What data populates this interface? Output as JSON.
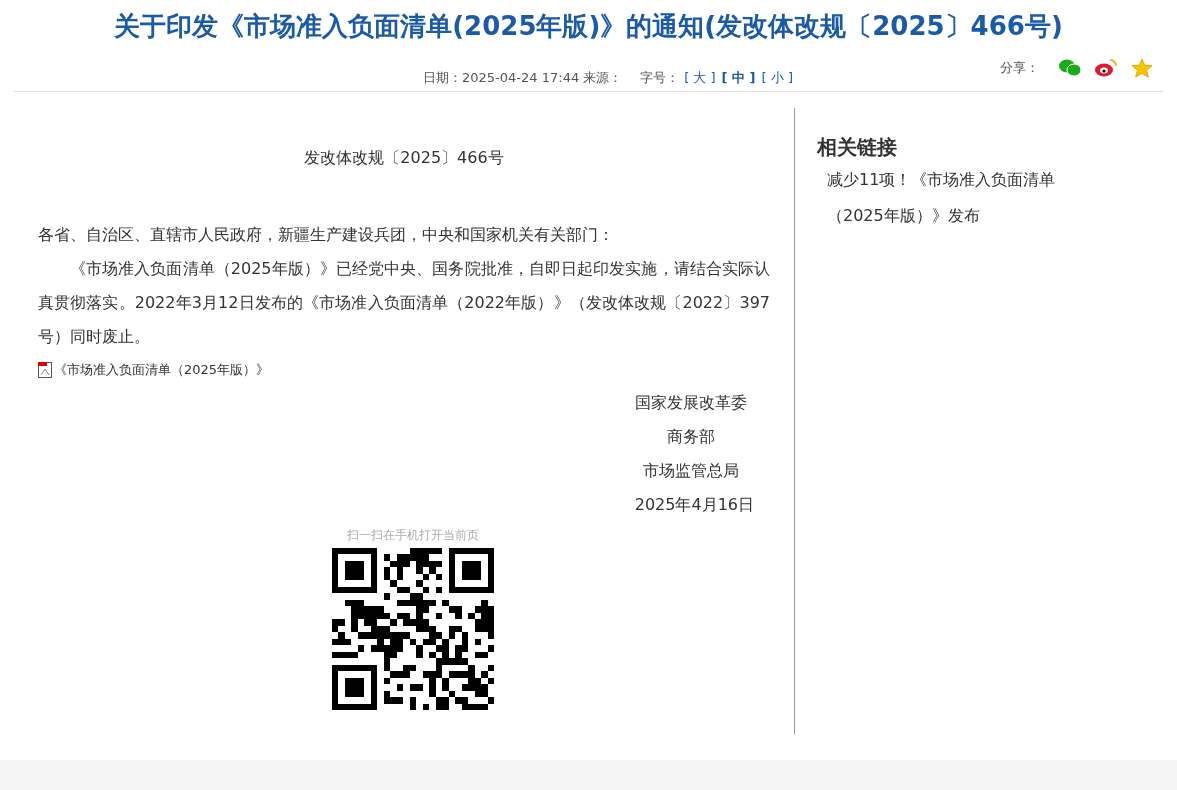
{
  "title": "关于印发《市场准入负面清单(2025年版)》的通知(发改体改规〔2025〕466号)",
  "meta": {
    "date": "日期：2025-04-24 17:44",
    "source": "来源：",
    "font_size_label": "字号：",
    "font_sizes": [
      {
        "label": "[ 大 ]",
        "selected": false
      },
      {
        "label": "[ 中 ]",
        "selected": true
      },
      {
        "label": "[ 小 ]",
        "selected": false
      }
    ],
    "share_label": "分享："
  },
  "article": {
    "doc_number": "发改体改规〔2025〕466号",
    "salutation": "各省、自治区、直辖市人民政府，新疆生产建设兵团，中央和国家机关有关部门：",
    "body": "《市场准入负面清单（2025年版）》已经党中央、国务院批准，自即日起印发实施，请结合实际认真贯彻落实。2022年3月12日发布的《市场准入负面清单（2022年版）》（发改体改规〔2022〕397号）同时废止。",
    "attachment": "《市场准入负面清单（2025年版）》",
    "signatures": [
      "国家发展改革委",
      "商务部",
      "市场监管总局"
    ],
    "date": "2025年4月16日",
    "qr_caption": "扫一扫在手机打开当前页"
  },
  "sidebar": {
    "title": "相关链接",
    "links": [
      "减少11项！《市场准入负面清单（2025年版）》发布"
    ]
  }
}
